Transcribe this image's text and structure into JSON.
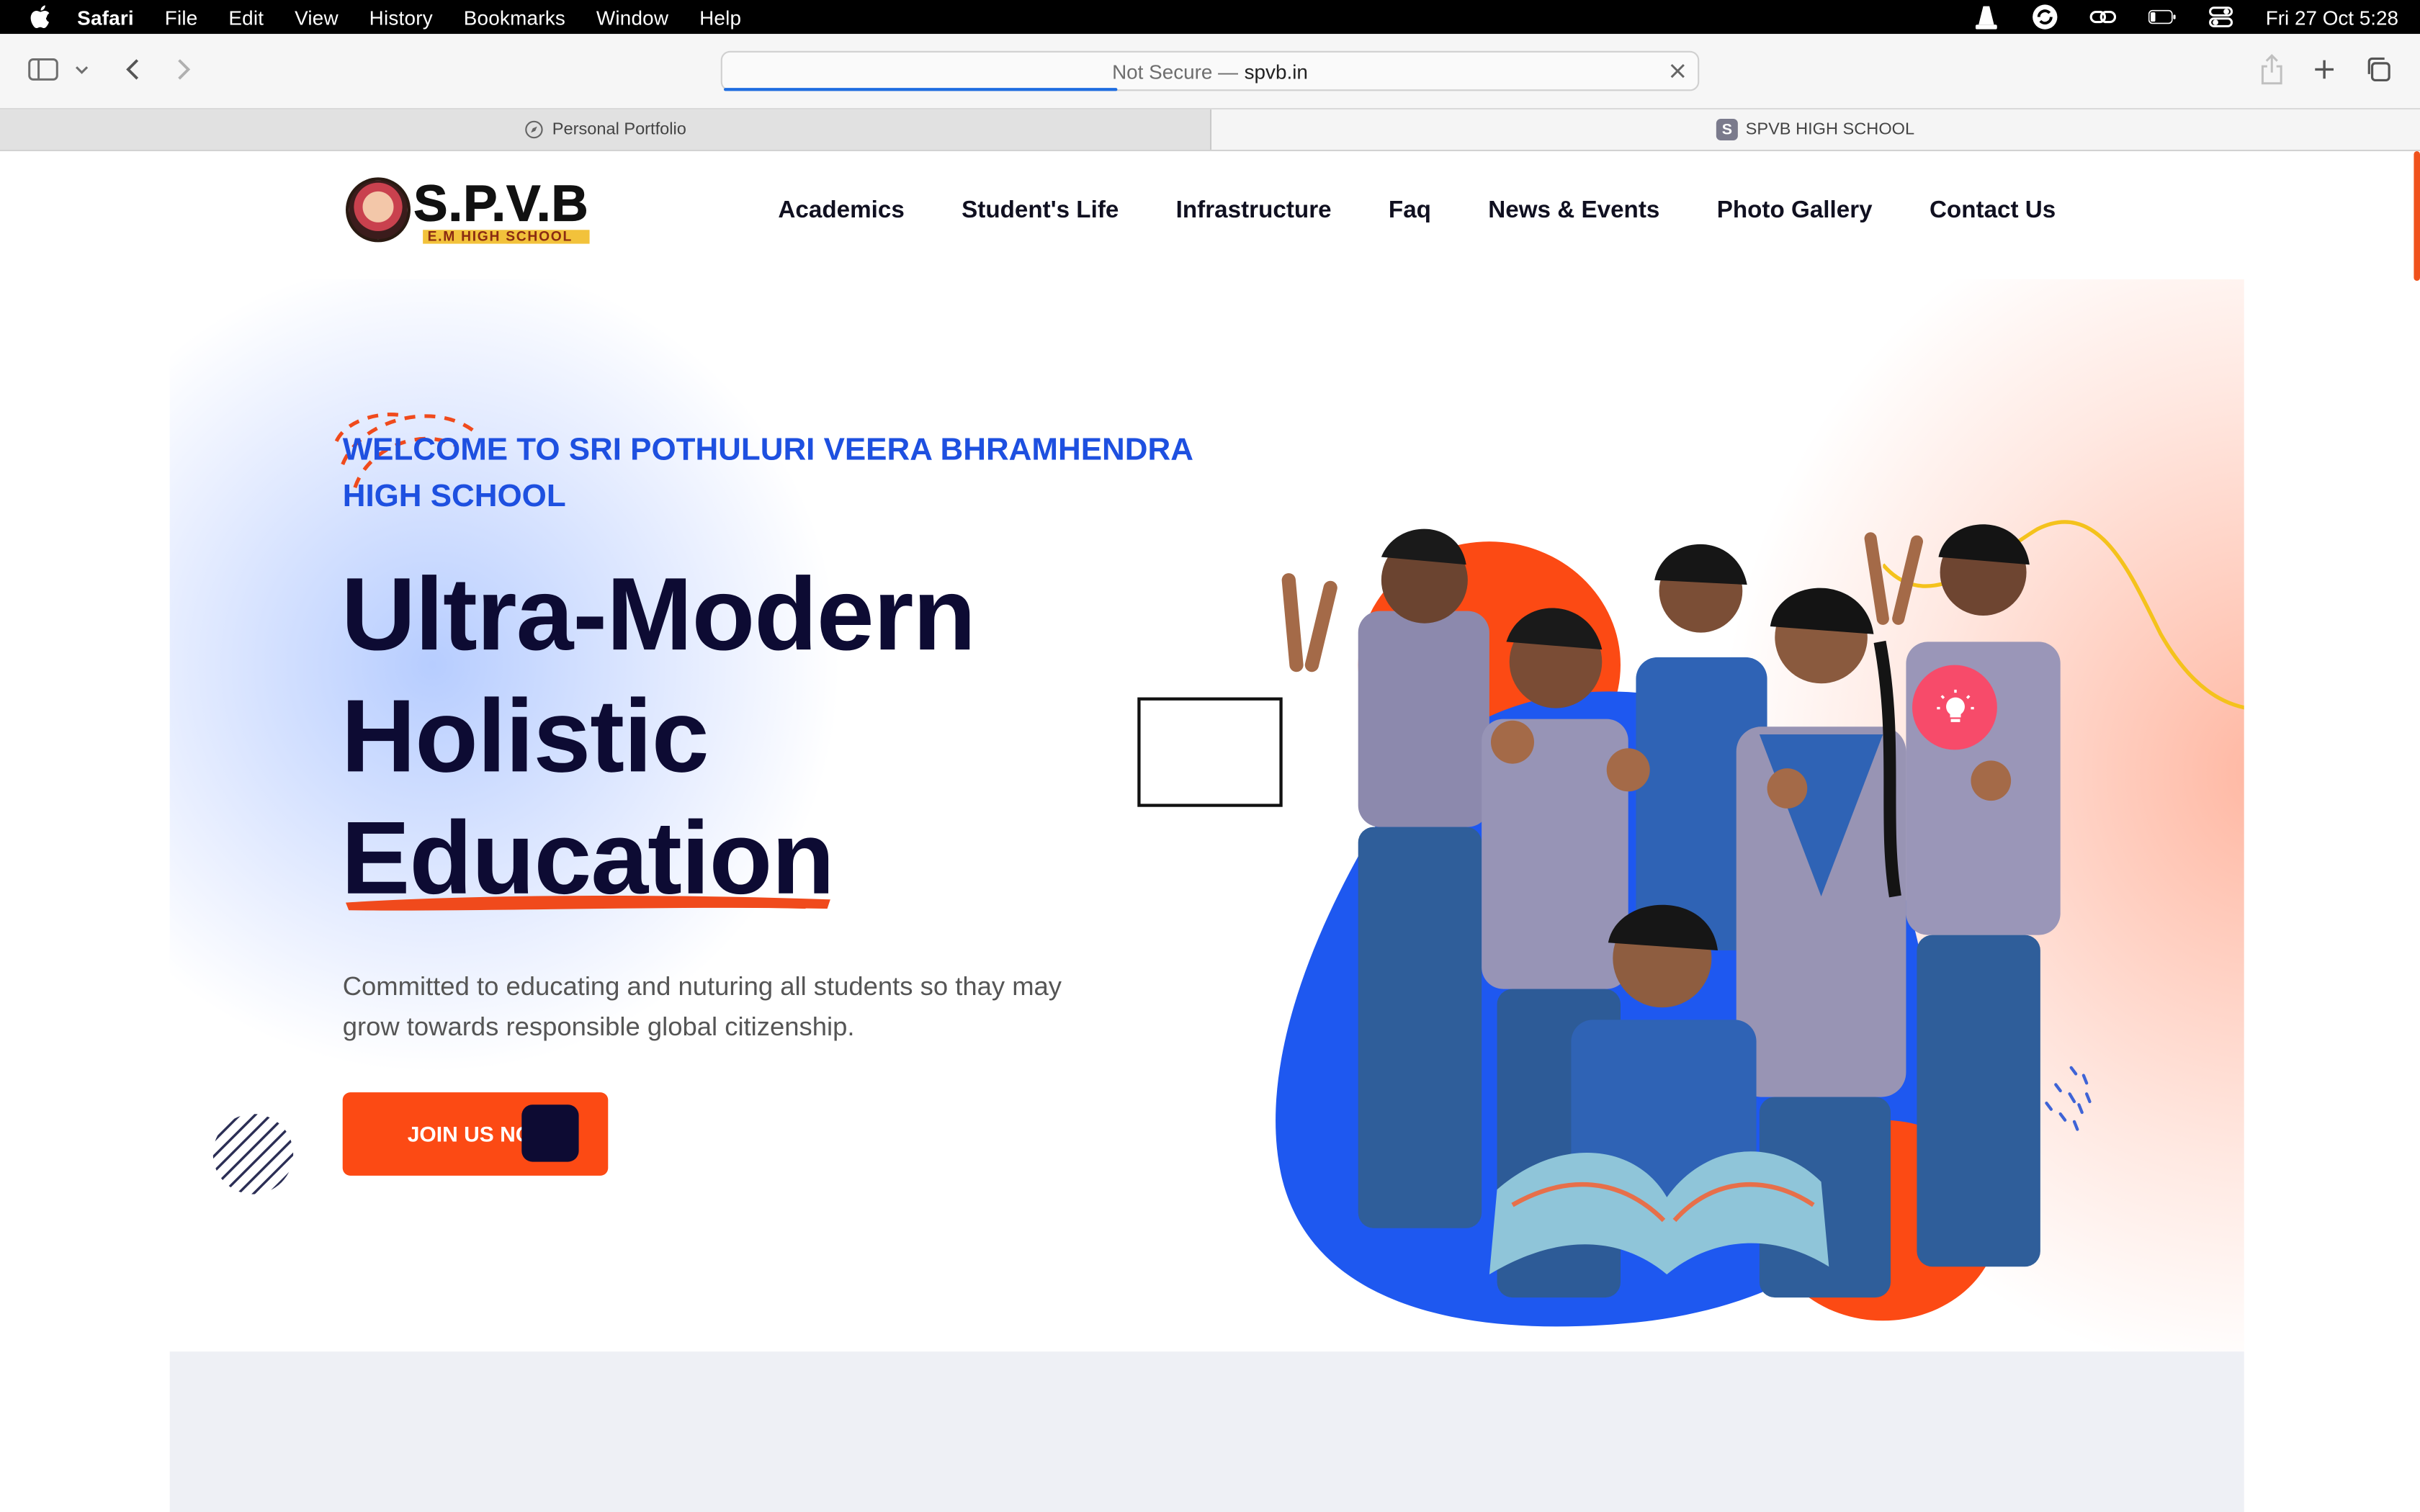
{
  "menubar": {
    "app": "Safari",
    "items": [
      "File",
      "Edit",
      "View",
      "History",
      "Bookmarks",
      "Window",
      "Help"
    ],
    "clock": "Fri 27 Oct  5:28"
  },
  "toolbar": {
    "address_prefix": "Not Secure —",
    "address_host": "spvb.in"
  },
  "tabs": [
    {
      "label": "Personal Portfolio",
      "active": false
    },
    {
      "label": "SPVB HIGH SCHOOL",
      "active": true,
      "favicon_letter": "S"
    }
  ],
  "site": {
    "logo": {
      "name": "S.P.V.B",
      "subtitle": "E.M HIGH SCHOOL"
    },
    "nav": [
      "Academics",
      "Student's Life",
      "Infrastructure",
      "Faq",
      "News & Events",
      "Photo Gallery",
      "Contact Us"
    ],
    "hero": {
      "welcome": "WELCOME TO SRI POTHULURI VEERA BHRAMHENDRA HIGH SCHOOL",
      "headline": [
        "Ultra-Modern",
        "Holistic",
        "Education"
      ],
      "description": "Committed to educating and nuturing all students so thay may grow towards responsible global citizenship.",
      "cta": "JOIN US NO"
    }
  },
  "colors": {
    "accent": "#fc4a14",
    "brand_blue": "#1e50e0",
    "headline": "#0d0b33"
  }
}
